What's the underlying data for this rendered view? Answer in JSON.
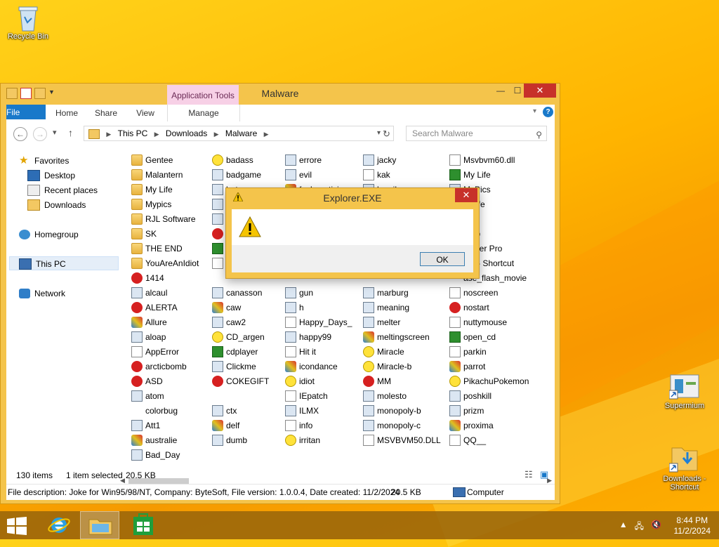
{
  "desktop": {
    "recycle_bin": "Recycle Bin",
    "supermium": "Supermium",
    "downloads_shortcut": "Downloads - Shortcut"
  },
  "window": {
    "title": "Malware",
    "contextual_tab": "Application Tools",
    "ribbon_tabs": [
      "File",
      "Home",
      "Share",
      "View",
      "Manage"
    ],
    "address": {
      "crumbs": [
        "This PC",
        "Downloads",
        "Malware"
      ]
    },
    "search_placeholder": "Search Malware"
  },
  "nav": {
    "favorites": "Favorites",
    "desktop": "Desktop",
    "recent": "Recent places",
    "downloads": "Downloads",
    "homegroup": "Homegroup",
    "thispc": "This PC",
    "network": "Network"
  },
  "files": {
    "col1": [
      {
        "name": "Gentee",
        "icon": "folder"
      },
      {
        "name": "Malantern",
        "icon": "folder"
      },
      {
        "name": "My Life",
        "icon": "folder"
      },
      {
        "name": "Mypics",
        "icon": "folder"
      },
      {
        "name": "RJL Software",
        "icon": "folder"
      },
      {
        "name": "SK",
        "icon": "folder"
      },
      {
        "name": "THE END",
        "icon": "folder"
      },
      {
        "name": "YouAreAnIdiot",
        "icon": "folder"
      },
      {
        "name": "1414",
        "icon": "red"
      },
      {
        "name": "alcaul",
        "icon": "app"
      },
      {
        "name": "ALERTA",
        "icon": "red"
      },
      {
        "name": "Allure",
        "icon": "multi"
      },
      {
        "name": "aloap",
        "icon": "app"
      },
      {
        "name": "AppError",
        "icon": "doc"
      },
      {
        "name": "arcticbomb",
        "icon": "red"
      },
      {
        "name": "ASD",
        "icon": "red"
      },
      {
        "name": "atom",
        "icon": "app"
      },
      {
        "name": "colorbug",
        "icon": "blank"
      },
      {
        "name": "Att1",
        "icon": "app"
      },
      {
        "name": "australie",
        "icon": "multi"
      },
      {
        "name": "Bad_Day",
        "icon": "app"
      }
    ],
    "col2": [
      {
        "name": "badass",
        "icon": "smile"
      },
      {
        "name": "badgame",
        "icon": "app"
      },
      {
        "name": "baton",
        "icon": "app"
      },
      {
        "name": "",
        "icon": "app"
      },
      {
        "name": "",
        "icon": "app"
      },
      {
        "name": "",
        "icon": "red"
      },
      {
        "name": "",
        "icon": "green"
      },
      {
        "name": "",
        "icon": "doc"
      },
      {
        "name": "",
        "icon": "blank"
      },
      {
        "name": "canasson",
        "icon": "app"
      },
      {
        "name": "caw",
        "icon": "multi"
      },
      {
        "name": "caw2",
        "icon": "app"
      },
      {
        "name": "CD_argen",
        "icon": "smile"
      },
      {
        "name": "cdplayer",
        "icon": "green"
      },
      {
        "name": "Clickme",
        "icon": "app"
      },
      {
        "name": "COKEGIFT",
        "icon": "red"
      },
      {
        "name": "",
        "icon": "blank"
      },
      {
        "name": "ctx",
        "icon": "app"
      },
      {
        "name": "delf",
        "icon": "multi"
      },
      {
        "name": "dumb",
        "icon": "app"
      },
      {
        "name": "",
        "icon": "blank"
      }
    ],
    "col3": [
      {
        "name": "errore",
        "icon": "app"
      },
      {
        "name": "evil",
        "icon": "app"
      },
      {
        "name": "fack_antivirus",
        "icon": "multi"
      },
      {
        "name": "",
        "icon": "blank"
      },
      {
        "name": "",
        "icon": "blank"
      },
      {
        "name": "",
        "icon": "blank"
      },
      {
        "name": "",
        "icon": "blank"
      },
      {
        "name": "",
        "icon": "blank"
      },
      {
        "name": "",
        "icon": "blank"
      },
      {
        "name": "gun",
        "icon": "app"
      },
      {
        "name": "h",
        "icon": "app"
      },
      {
        "name": "Happy_Days_",
        "icon": "doc"
      },
      {
        "name": "happy99",
        "icon": "app"
      },
      {
        "name": "Hit it",
        "icon": "doc"
      },
      {
        "name": "icondance",
        "icon": "multi"
      },
      {
        "name": "idiot",
        "icon": "smile"
      },
      {
        "name": "IEpatch",
        "icon": "doc"
      },
      {
        "name": "ILMX",
        "icon": "app"
      },
      {
        "name": "info",
        "icon": "doc"
      },
      {
        "name": "irritan",
        "icon": "smile"
      },
      {
        "name": "",
        "icon": "blank"
      }
    ],
    "col4": [
      {
        "name": "jacky",
        "icon": "app"
      },
      {
        "name": "kak",
        "icon": "doc"
      },
      {
        "name": "kamikaze",
        "icon": "app"
      },
      {
        "name": "",
        "icon": "blank"
      },
      {
        "name": "",
        "icon": "blank"
      },
      {
        "name": "",
        "icon": "blank"
      },
      {
        "name": "",
        "icon": "blank"
      },
      {
        "name": "",
        "icon": "blank"
      },
      {
        "name": "",
        "icon": "blank"
      },
      {
        "name": "marburg",
        "icon": "app"
      },
      {
        "name": "meaning",
        "icon": "app"
      },
      {
        "name": "melter",
        "icon": "app"
      },
      {
        "name": "meltingscreen",
        "icon": "multi"
      },
      {
        "name": "Miracle",
        "icon": "smile"
      },
      {
        "name": "Miracle-b",
        "icon": "smile"
      },
      {
        "name": "MM",
        "icon": "red"
      },
      {
        "name": "molesto",
        "icon": "app"
      },
      {
        "name": "monopoly-b",
        "icon": "app"
      },
      {
        "name": "monopoly-c",
        "icon": "app"
      },
      {
        "name": "MSVBVM50.DLL",
        "icon": "doc"
      },
      {
        "name": "",
        "icon": "blank"
      }
    ],
    "col5": [
      {
        "name": "Msvbvm60.dll",
        "icon": "doc"
      },
      {
        "name": "My Life",
        "icon": "green"
      },
      {
        "name": "MyPics",
        "icon": "app"
      },
      {
        "name": "dWife",
        "icon": "blank"
      },
      {
        "name": "ad",
        "icon": "blank"
      },
      {
        "name": "ad-b",
        "icon": "blank"
      },
      {
        "name": "atcher Pro",
        "icon": "blank"
      },
      {
        "name": "ork - Shortcut",
        "icon": "blank"
      },
      {
        "name": "ase_flash_movie",
        "icon": "blank"
      },
      {
        "name": "noscreen",
        "icon": "doc"
      },
      {
        "name": "nostart",
        "icon": "red"
      },
      {
        "name": "nuttymouse",
        "icon": "doc"
      },
      {
        "name": "open_cd",
        "icon": "green"
      },
      {
        "name": "parkin",
        "icon": "doc"
      },
      {
        "name": "parrot",
        "icon": "multi"
      },
      {
        "name": "PikachuPokemon",
        "icon": "smile"
      },
      {
        "name": "poshkill",
        "icon": "app"
      },
      {
        "name": "prizm",
        "icon": "app"
      },
      {
        "name": "proxima",
        "icon": "multi"
      },
      {
        "name": "QQ__",
        "icon": "doc"
      },
      {
        "name": "",
        "icon": "blank"
      }
    ]
  },
  "status": {
    "count": "130 items",
    "selected": "1 item selected",
    "size": "20.5 KB"
  },
  "details": {
    "description": "File description: Joke for Win95/98/NT, Company: ByteSoft, File version: 1.0.0.4, Date created: 11/2/2024",
    "size": "20.5 KB",
    "location": "Computer"
  },
  "dialog": {
    "title": "Explorer.EXE",
    "ok": "OK"
  },
  "taskbar": {
    "time": "8:44 PM",
    "date": "11/2/2024"
  }
}
